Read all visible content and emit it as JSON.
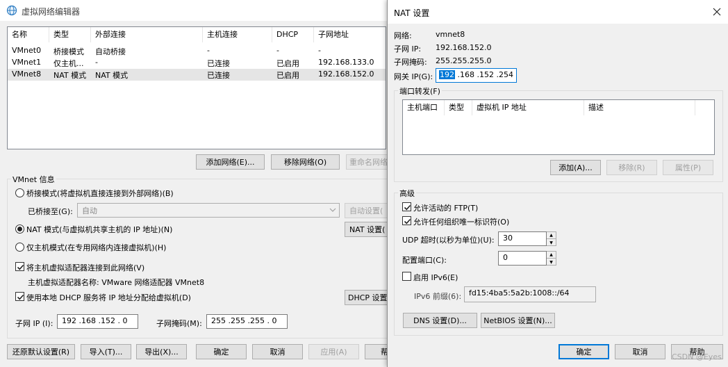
{
  "editor": {
    "title": "虚拟网络编辑器",
    "columns": [
      "名称",
      "类型",
      "外部连接",
      "主机连接",
      "DHCP",
      "子网地址"
    ],
    "rows": [
      {
        "name": "VMnet0",
        "type": "桥接模式",
        "external": "自动桥接",
        "host": "-",
        "dhcp": "-",
        "subnet": "-"
      },
      {
        "name": "VMnet1",
        "type": "仅主机...",
        "external": "-",
        "host": "已连接",
        "dhcp": "已启用",
        "subnet": "192.168.133.0"
      },
      {
        "name": "VMnet8",
        "type": "NAT 模式",
        "external": "NAT 模式",
        "host": "已连接",
        "dhcp": "已启用",
        "subnet": "192.168.152.0"
      }
    ],
    "add_network": "添加网络(E)...",
    "remove_network": "移除网络(O)",
    "rename_network": "重命名网络",
    "vmnet_info_title": "VMnet 信息",
    "bridge_mode": "桥接模式(将虚拟机直接连接到外部网络)(B)",
    "bridged_to_label": "已桥接至(G):",
    "bridged_to_value": "自动",
    "auto_settings": "自动设置(",
    "nat_mode": "NAT 模式(与虚拟机共享主机的 IP 地址)(N)",
    "nat_settings": "NAT 设置(",
    "host_only_mode": "仅主机模式(在专用网络内连接虚拟机)(H)",
    "connect_adapter": "将主机虚拟适配器连接到此网络(V)",
    "adapter_name": "主机虚拟适配器名称: VMware 网络适配器 VMnet8",
    "use_dhcp": "使用本地 DHCP 服务将 IP 地址分配给虚拟机(D)",
    "dhcp_settings": "DHCP 设置(",
    "subnet_ip_label": "子网 IP (I):",
    "subnet_ip_value": "192 .168 .152 . 0",
    "subnet_mask_label": "子网掩码(M):",
    "subnet_mask_value": "255 .255 .255 . 0",
    "restore_defaults": "还原默认设置(R)",
    "import": "导入(T)...",
    "export": "导出(X)...",
    "ok": "确定",
    "cancel": "取消",
    "apply": "应用(A)",
    "help_partial": "帮"
  },
  "nat": {
    "title": "NAT 设置",
    "network_label": "网络:",
    "network_value": "vmnet8",
    "subnet_ip_label": "子网 IP:",
    "subnet_ip_value": "192.168.152.0",
    "subnet_mask_label": "子网掩码:",
    "subnet_mask_value": "255.255.255.0",
    "gateway_label": "网关 IP(G):",
    "gateway_sel": "192",
    "gateway_rest": " .168 .152 .254",
    "port_forward_title": "端口转发(F)",
    "pf_columns": [
      "主机端口",
      "类型",
      "虚拟机 IP 地址",
      "描述"
    ],
    "add": "添加(A)...",
    "remove": "移除(R)",
    "properties": "属性(P)",
    "advanced_title": "高级",
    "allow_ftp": "允许活动的 FTP(T)",
    "allow_uid": "允许任何组织唯一标识符(O)",
    "udp_timeout_label": "UDP 超时(以秒为单位)(U):",
    "udp_timeout_value": "30",
    "config_port_label": "配置端口(C):",
    "config_port_value": "0",
    "enable_ipv6": "启用 IPv6(E)",
    "ipv6_prefix_label": "IPv6 前缀(6):",
    "ipv6_prefix_value": "fd15:4ba5:5a2b:1008::/64",
    "dns_settings": "DNS 设置(D)...",
    "netbios_settings": "NetBIOS 设置(N)...",
    "ok": "确定",
    "cancel": "取消",
    "help": "帮助"
  },
  "watermark": "CSDN @Eyes",
  "colors": {
    "accent": "#0078d7",
    "selection": "#0078d7"
  }
}
